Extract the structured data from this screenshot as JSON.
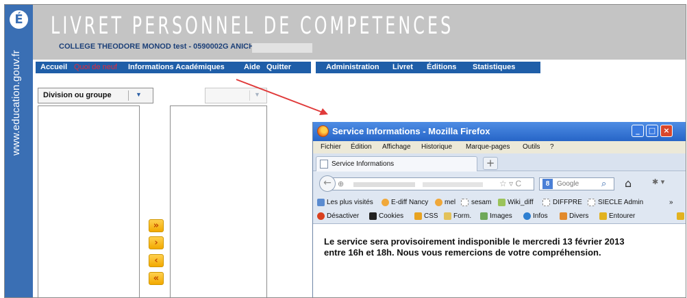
{
  "side": {
    "logo_letter": "É",
    "domain": "www.education.gouv.fr"
  },
  "header": {
    "title": "LIVRET PERSONNEL DE COMPETENCES",
    "college": "COLLEGE THEODORE MONOD test - 0590002G ANICHE -"
  },
  "nav": {
    "left": [
      "Accueil",
      "Quoi de neuf",
      "Informations Académiques",
      "Aide",
      "Quitter"
    ],
    "right": [
      "Administration",
      "Livret",
      "Éditions",
      "Statistiques"
    ]
  },
  "content": {
    "division_select": "Division ou groupe",
    "buttons": [
      "»",
      "›",
      "‹",
      "«"
    ]
  },
  "firefox": {
    "title": "Service Informations - Mozilla Firefox",
    "window_buttons": [
      "_",
      "□",
      "×"
    ],
    "menu": [
      "Fichier",
      "Édition",
      "Affichage",
      "Historique",
      "Marque-pages",
      "Outils",
      "?"
    ],
    "tab_label": "Service Informations",
    "new_tab": "+",
    "search_placeholder": "Google",
    "bookmarks": [
      "Les plus visités",
      "E-diff Nancy",
      "mel",
      "sesam",
      "Wiki_diff",
      "DIFFPRE",
      "SIECLE Admin"
    ],
    "bookmarks_more": "»",
    "toolbar": [
      "Désactiver",
      "Cookies",
      "CSS",
      "Form.",
      "Images",
      "Infos",
      "Divers",
      "Entourer"
    ],
    "message": "Le service sera provisoirement indisponible le mercredi 13 février 2013 entre 16h et 18h. Nous vous remercions de votre compréhension."
  },
  "colors": {
    "nav_blue": "#1f5ea8",
    "strip_blue": "#3a6fb4",
    "header_grey": "#c4c4c4",
    "active_red": "#e52a3a",
    "arrow_red": "#e03a3a",
    "button_orange": "#f2a900"
  },
  "icons": {
    "firefox": "firefox-logo-icon",
    "back": "back-arrow-icon",
    "home": "home-icon",
    "search": "magnifier-icon"
  }
}
